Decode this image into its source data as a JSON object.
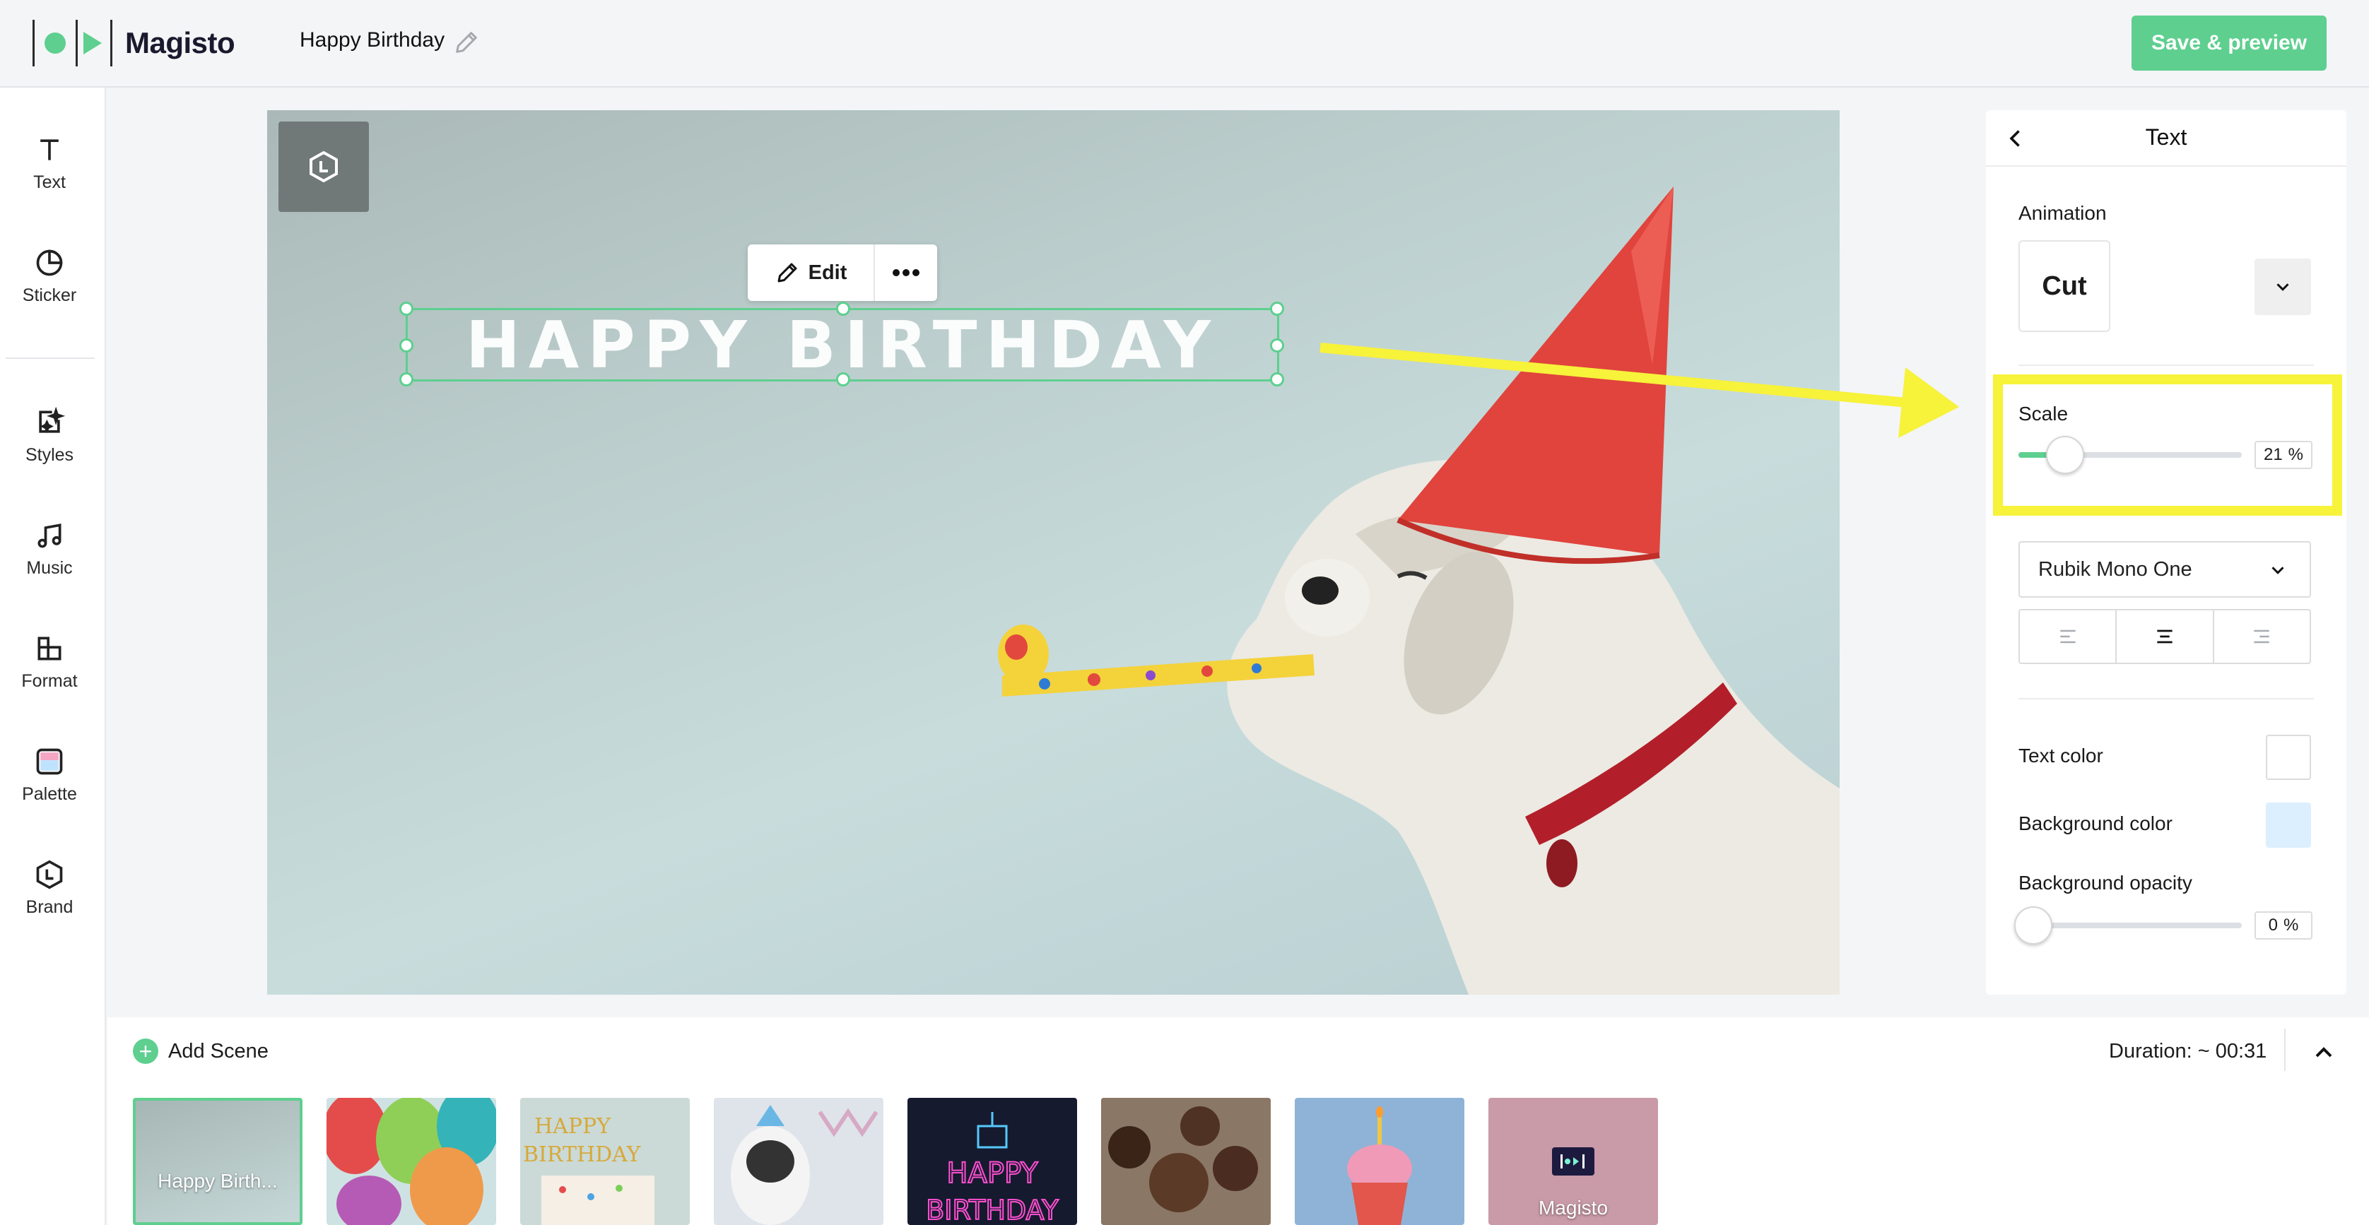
{
  "app": {
    "brand": "Magisto",
    "project_title": "Happy Birthday",
    "save_button": "Save & preview"
  },
  "sidebar": {
    "items": [
      {
        "label": "Text",
        "icon": "text-icon"
      },
      {
        "label": "Sticker",
        "icon": "sticker-icon"
      },
      {
        "label": "Styles",
        "icon": "styles-icon"
      },
      {
        "label": "Music",
        "icon": "music-icon"
      },
      {
        "label": "Format",
        "icon": "format-icon"
      },
      {
        "label": "Palette",
        "icon": "palette-icon"
      },
      {
        "label": "Brand",
        "icon": "brand-icon"
      }
    ]
  },
  "canvas": {
    "overlay_text": "HAPPY BIRTHDAY",
    "toolbar": {
      "edit_label": "Edit"
    }
  },
  "panel": {
    "title": "Text",
    "animation": {
      "label": "Animation",
      "value": "Cut"
    },
    "scale": {
      "label": "Scale",
      "value": "21",
      "unit": "%",
      "level_percent": 21
    },
    "font": {
      "value": "Rubik Mono One"
    },
    "text_color": {
      "label": "Text color",
      "color": "#ffffff"
    },
    "background_color": {
      "label": "Background color",
      "color": "#dcefff"
    },
    "background_opacity": {
      "label": "Background opacity",
      "value": "0",
      "unit": "%",
      "level_percent": 0
    }
  },
  "annotation": {
    "color": "#f7f23a"
  },
  "scenes": {
    "add_label": "Add Scene",
    "duration": "Duration: ~ 00:31",
    "thumbnails": [
      {
        "label": "Happy Birth...",
        "selected": true
      },
      {
        "label": ""
      },
      {
        "label": ""
      },
      {
        "label": ""
      },
      {
        "label": ""
      },
      {
        "label": ""
      },
      {
        "label": ""
      },
      {
        "label": "Magisto"
      }
    ]
  },
  "colors": {
    "accent": "#5ecf8f",
    "canvas_bg": "#c2d6d5",
    "annotation": "#f7f23a"
  }
}
